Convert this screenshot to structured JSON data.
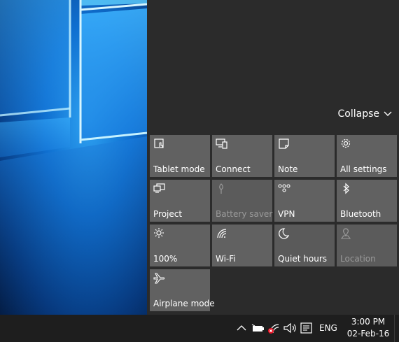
{
  "action_center": {
    "collapse_label": "Collapse",
    "tiles": [
      {
        "label": "Tablet mode",
        "icon": "tablet-mode-icon",
        "state": "normal"
      },
      {
        "label": "Connect",
        "icon": "connect-icon",
        "state": "normal"
      },
      {
        "label": "Note",
        "icon": "note-icon",
        "state": "normal"
      },
      {
        "label": "All settings",
        "icon": "settings-gear-icon",
        "state": "normal"
      },
      {
        "label": "Project",
        "icon": "project-icon",
        "state": "normal"
      },
      {
        "label": "Battery saver",
        "icon": "battery-saver-icon",
        "state": "disabled"
      },
      {
        "label": "VPN",
        "icon": "vpn-icon",
        "state": "normal"
      },
      {
        "label": "Bluetooth",
        "icon": "bluetooth-icon",
        "state": "normal"
      },
      {
        "label": "100%",
        "icon": "brightness-icon",
        "state": "normal"
      },
      {
        "label": "Wi-Fi",
        "icon": "wifi-icon",
        "state": "normal"
      },
      {
        "label": "Quiet hours",
        "icon": "moon-icon",
        "state": "normal"
      },
      {
        "label": "Location",
        "icon": "location-icon",
        "state": "disabled"
      },
      {
        "label": "Airplane mode",
        "icon": "airplane-icon",
        "state": "normal"
      }
    ]
  },
  "taskbar": {
    "language": "ENG",
    "time": "3:00 PM",
    "date": "02-Feb-16",
    "tray_icons": [
      "chevron-up-icon",
      "battery-icon",
      "network-disconnected-icon",
      "volume-icon",
      "action-center-icon"
    ]
  },
  "colors": {
    "panel": "#2b2b2b",
    "tile": "#616161",
    "taskbar": "#1e1e1e",
    "disabled_text": "#9a9a9a",
    "error_red": "#e81123"
  }
}
